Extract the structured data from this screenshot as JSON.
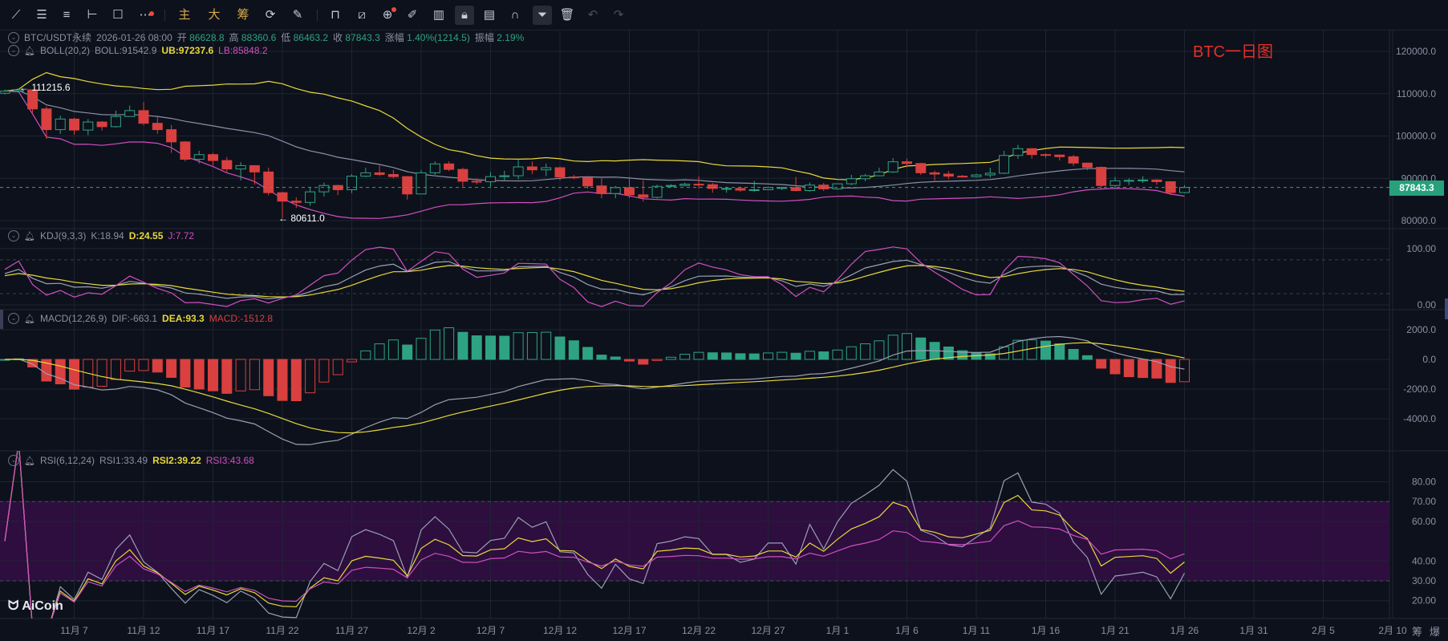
{
  "toolbar": {
    "main_label": "主",
    "big_label": "大",
    "chip_label": "筹"
  },
  "header": {
    "symbol": "BTC/USDT永续",
    "datetime": "2026-01-26 08:00",
    "open_label": "开",
    "open": "86628.8",
    "high_label": "高",
    "high": "88360.6",
    "low_label": "低",
    "low": "86463.2",
    "close_label": "收",
    "close": "87843.3",
    "change_label": "涨幅",
    "change": "1.40%(1214.5)",
    "amplitude_label": "振幅",
    "amplitude": "2.19%"
  },
  "boll": {
    "name": "BOLL(20,2)",
    "boll": "BOLL:91542.9",
    "ub": "UB:97237.6",
    "lb": "LB:85848.2"
  },
  "kdj": {
    "name": "KDJ(9,3,3)",
    "k": "K:18.94",
    "d": "D:24.55",
    "j": "J:7.72"
  },
  "macd": {
    "name": "MACD(12,26,9)",
    "dif": "DIF:-663.1",
    "dea": "DEA:93.3",
    "macd": "MACD:-1512.8"
  },
  "rsi": {
    "name": "RSI(6,12,24)",
    "rsi1": "RSI1:33.49",
    "rsi2": "RSI2:39.22",
    "rsi3": "RSI3:43.68"
  },
  "chart_note": "BTC一日图",
  "last_price": "87843.3",
  "max_marker": "← 111215.6",
  "min_marker": "← 80611.0",
  "logo": "AiCoin",
  "corner_buttons": [
    "筹",
    "爆"
  ],
  "colors": {
    "up": "#2ea383",
    "down": "#d9403f",
    "ub": "#e8d83a",
    "lb": "#d04fc2",
    "mid": "#8b90a8",
    "rsi_band": "#2d0e3e"
  },
  "axes": {
    "price_ticks": [
      "120000.0",
      "110000.0",
      "100000.0",
      "90000.0",
      "80000.0"
    ],
    "kdj_ticks": [
      "100.00",
      "0.00"
    ],
    "macd_ticks": [
      "2000.0",
      "0.0",
      "-2000.0",
      "-4000.0"
    ],
    "rsi_ticks": [
      "80.00",
      "70.00",
      "60.00",
      "40.00",
      "30.00",
      "20.00"
    ],
    "x_labels": [
      "11月 7",
      "11月 12",
      "11月 17",
      "11月 22",
      "11月 27",
      "12月 2",
      "12月 7",
      "12月 12",
      "12月 17",
      "12月 22",
      "12月 27",
      "1月 1",
      "1月 6",
      "1月 11",
      "1月 16",
      "1月 21",
      "1月 26",
      "1月 31",
      "2月 5",
      "2月 10"
    ]
  },
  "chart_data": {
    "type": "candlestick",
    "unit": "thousand USDT",
    "first_open": 110.1,
    "hlc": [
      [
        111.0,
        109.8,
        110.6
      ],
      [
        111.2156,
        110.2,
        110.9
      ],
      [
        111.0,
        105.5,
        106.4
      ],
      [
        107.0,
        99.3,
        101.5
      ],
      [
        104.8,
        100.5,
        104.0
      ],
      [
        104.3,
        100.3,
        101.4
      ],
      [
        104.0,
        100.2,
        103.3
      ],
      [
        103.5,
        101.3,
        102.2
      ],
      [
        106.0,
        102.0,
        104.6
      ],
      [
        107.2,
        105.0,
        106.0
      ],
      [
        108.0,
        102.5,
        103.0
      ],
      [
        104.5,
        100.5,
        101.5
      ],
      [
        102.6,
        96.0,
        98.6
      ],
      [
        98.8,
        94.0,
        94.5
      ],
      [
        96.5,
        93.5,
        95.6
      ],
      [
        96.0,
        93.0,
        94.2
      ],
      [
        95.0,
        91.5,
        92.2
      ],
      [
        93.8,
        89.5,
        93.0
      ],
      [
        93.0,
        88.5,
        91.5
      ],
      [
        92.5,
        86.0,
        86.6
      ],
      [
        86.8,
        80.611,
        84.6
      ],
      [
        85.5,
        83.0,
        84.3
      ],
      [
        88.0,
        83.5,
        86.8
      ],
      [
        89.0,
        85.7,
        88.3
      ],
      [
        88.5,
        86.0,
        87.3
      ],
      [
        91.0,
        86.5,
        90.5
      ],
      [
        92.5,
        90.3,
        91.3
      ],
      [
        93.0,
        90.5,
        90.9
      ],
      [
        92.0,
        90.0,
        90.4
      ],
      [
        90.5,
        85.0,
        86.3
      ],
      [
        92.0,
        86.3,
        91.3
      ],
      [
        94.0,
        90.8,
        93.4
      ],
      [
        94.0,
        91.7,
        92.1
      ],
      [
        92.5,
        88.0,
        89.3
      ],
      [
        90.0,
        88.6,
        89.2
      ],
      [
        91.5,
        88.0,
        90.4
      ],
      [
        91.8,
        89.6,
        90.6
      ],
      [
        94.5,
        89.8,
        92.7
      ],
      [
        94.0,
        91.0,
        92.0
      ],
      [
        93.5,
        90.5,
        92.5
      ],
      [
        92.8,
        89.5,
        90.3
      ],
      [
        90.8,
        89.8,
        90.2
      ],
      [
        90.5,
        87.6,
        88.2
      ],
      [
        90.0,
        85.3,
        86.4
      ],
      [
        88.2,
        85.3,
        87.8
      ],
      [
        90.3,
        85.3,
        86.1
      ],
      [
        89.5,
        84.5,
        85.5
      ],
      [
        88.5,
        85.2,
        88.1
      ],
      [
        88.6,
        87.9,
        88.3
      ],
      [
        89.0,
        88.1,
        88.6
      ],
      [
        90.5,
        87.6,
        88.5
      ],
      [
        88.9,
        86.6,
        87.6
      ],
      [
        88.0,
        86.6,
        87.6
      ],
      [
        88.0,
        86.8,
        87.2
      ],
      [
        89.4,
        86.8,
        87.3
      ],
      [
        88.0,
        87.3,
        87.8
      ],
      [
        88.0,
        87.2,
        87.8
      ],
      [
        90.3,
        86.9,
        87.1
      ],
      [
        89.0,
        86.8,
        88.4
      ],
      [
        88.9,
        87.0,
        87.5
      ],
      [
        88.8,
        87.3,
        88.7
      ],
      [
        90.8,
        88.4,
        89.9
      ],
      [
        91.0,
        89.3,
        90.6
      ],
      [
        92.5,
        90.5,
        91.5
      ],
      [
        94.8,
        91.3,
        93.9
      ],
      [
        94.7,
        92.6,
        93.5
      ],
      [
        93.6,
        90.8,
        91.3
      ],
      [
        91.8,
        89.5,
        91.0
      ],
      [
        91.7,
        89.8,
        90.5
      ],
      [
        90.8,
        90.2,
        90.4
      ],
      [
        91.1,
        90.2,
        90.8
      ],
      [
        92.5,
        90.2,
        91.2
      ],
      [
        96.5,
        91.0,
        95.4
      ],
      [
        97.9,
        94.6,
        97.0
      ],
      [
        97.1,
        94.6,
        95.6
      ],
      [
        95.9,
        94.8,
        95.5
      ],
      [
        95.6,
        94.2,
        95.1
      ],
      [
        95.5,
        92.9,
        93.6
      ],
      [
        93.6,
        91.9,
        92.6
      ],
      [
        92.8,
        87.3,
        88.3
      ],
      [
        90.3,
        87.5,
        89.4
      ],
      [
        90.0,
        88.4,
        89.5
      ],
      [
        90.5,
        88.9,
        89.6
      ],
      [
        89.8,
        88.5,
        89.2
      ],
      [
        89.3,
        86.1,
        86.6288
      ],
      [
        88.3606,
        86.4632,
        87.8433
      ]
    ]
  }
}
